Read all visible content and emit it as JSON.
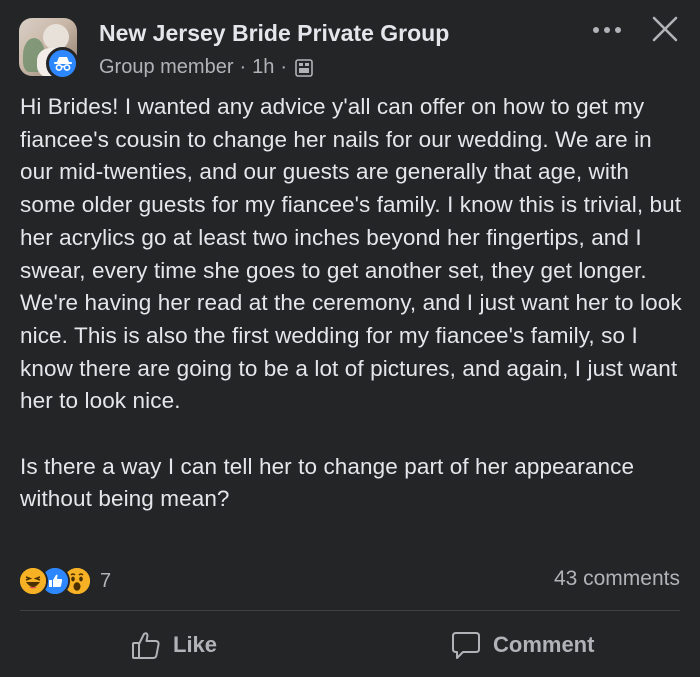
{
  "header": {
    "group_name": "New Jersey Bride Private Group",
    "member_role": "Group member",
    "separator": "·",
    "time_ago": "1h",
    "audience_icon": "photo-frame-icon"
  },
  "toolbar": {
    "more_icon": "more-dots-icon",
    "close_icon": "close-icon"
  },
  "post": {
    "text": "Hi Brides! I wanted any advice y'all can offer on how to get my fiancee's cousin to change her nails for our wedding. We are in our mid-twenties, and our guests are generally that age, with some older guests for my fiancee's family. I know this is trivial, but her acrylics go at least two inches beyond her fingertips, and I swear, every time she goes to get another set, they get longer. We're having her read at the ceremony, and I just want her to look nice. This is also the first wedding for my fiancee's family, so I know there are going to be a lot of pictures, and again, I just want her to look nice.\n\nIs there a way I can tell her to change part of her appearance without being mean?"
  },
  "engagement": {
    "reactions": [
      "haha",
      "like",
      "wow"
    ],
    "reaction_count": "7",
    "comments_label": "43 comments"
  },
  "actions": {
    "like_label": "Like",
    "comment_label": "Comment"
  },
  "colors": {
    "background": "#242526",
    "primary_text": "#e4e6eb",
    "secondary_text": "#b0b3b8",
    "accent_blue": "#2d88ff",
    "reaction_yellow": "#f7b125"
  }
}
